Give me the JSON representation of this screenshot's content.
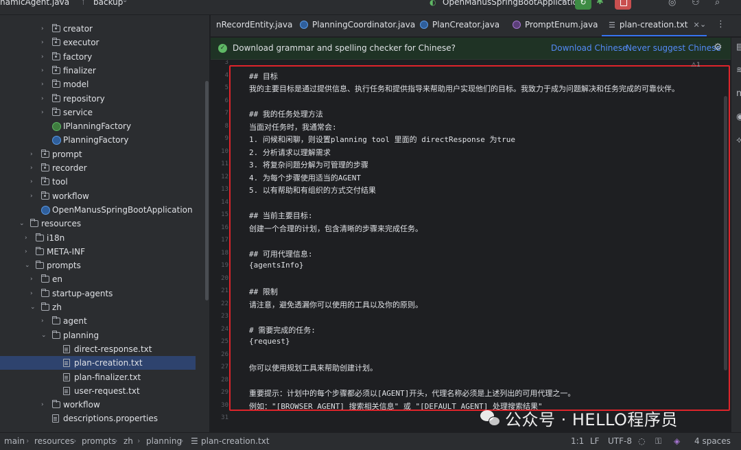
{
  "titlebar": {
    "project": "namicAgent.java",
    "branch": "backup",
    "run_config": "OpenManusSpringBootApplication"
  },
  "sidebar": {
    "items": [
      {
        "label": "creator",
        "type": "package",
        "indent": 2,
        "expandable": true
      },
      {
        "label": "executor",
        "type": "package",
        "indent": 2,
        "expandable": true
      },
      {
        "label": "factory",
        "type": "package",
        "indent": 2,
        "expandable": true
      },
      {
        "label": "finalizer",
        "type": "package",
        "indent": 2,
        "expandable": true
      },
      {
        "label": "model",
        "type": "package",
        "indent": 2,
        "expandable": true
      },
      {
        "label": "repository",
        "type": "package",
        "indent": 2,
        "expandable": true
      },
      {
        "label": "service",
        "type": "package",
        "indent": 2,
        "expandable": true
      },
      {
        "label": "IPlanningFactory",
        "type": "interface",
        "indent": 2,
        "expandable": false
      },
      {
        "label": "PlanningFactory",
        "type": "class",
        "indent": 2,
        "expandable": false
      },
      {
        "label": "prompt",
        "type": "package",
        "indent": 1,
        "expandable": true
      },
      {
        "label": "recorder",
        "type": "package",
        "indent": 1,
        "expandable": true
      },
      {
        "label": "tool",
        "type": "package",
        "indent": 1,
        "expandable": true
      },
      {
        "label": "workflow",
        "type": "package",
        "indent": 1,
        "expandable": true
      },
      {
        "label": "OpenManusSpringBootApplication",
        "type": "app",
        "indent": 1,
        "expandable": false
      },
      {
        "label": "resources",
        "type": "folder",
        "indent": 0,
        "expanded": true
      },
      {
        "label": "i18n",
        "type": "folder",
        "indent": 0.5,
        "expandable": true
      },
      {
        "label": "META-INF",
        "type": "folder",
        "indent": 0.5,
        "expandable": true
      },
      {
        "label": "prompts",
        "type": "folder",
        "indent": 0.5,
        "expanded": true
      },
      {
        "label": "en",
        "type": "folder",
        "indent": 1,
        "expandable": true
      },
      {
        "label": "startup-agents",
        "type": "folder",
        "indent": 1,
        "expandable": true
      },
      {
        "label": "zh",
        "type": "folder",
        "indent": 1,
        "expanded": true
      },
      {
        "label": "agent",
        "type": "folder",
        "indent": 2,
        "expandable": true
      },
      {
        "label": "planning",
        "type": "folder",
        "indent": 2,
        "expanded": true
      },
      {
        "label": "direct-response.txt",
        "type": "file",
        "indent": 3
      },
      {
        "label": "plan-creation.txt",
        "type": "file",
        "indent": 3,
        "selected": true
      },
      {
        "label": "plan-finalizer.txt",
        "type": "file",
        "indent": 3
      },
      {
        "label": "user-request.txt",
        "type": "file",
        "indent": 3
      },
      {
        "label": "workflow",
        "type": "folder",
        "indent": 2,
        "expandable": true
      },
      {
        "label": "descriptions.properties",
        "type": "file",
        "indent": 2
      }
    ]
  },
  "tabs": [
    {
      "label": "nRecordEntity.java",
      "icon": "class-icon"
    },
    {
      "label": "PlanningCoordinator.java",
      "icon": "class-icon"
    },
    {
      "label": "PlanCreator.java",
      "icon": "class-icon"
    },
    {
      "label": "PromptEnum.java",
      "icon": "enum-icon"
    },
    {
      "label": "plan-creation.txt",
      "icon": "text-file-icon",
      "active": true
    }
  ],
  "notification": {
    "message": "Download grammar and spelling checker for Chinese?",
    "action_download": "Download Chinese",
    "action_never": "Never suggest Chinese"
  },
  "editor": {
    "inspection": "⚠1",
    "lines": [
      {
        "n": "3",
        "text": ""
      },
      {
        "n": "4",
        "text": "## 目标"
      },
      {
        "n": "5",
        "text": "我的主要目标是通过提供信息、执行任务和提供指导来帮助用户实现他们的目标。我致力于成为问题解决和任务完成的可靠伙伴。"
      },
      {
        "n": "6",
        "text": ""
      },
      {
        "n": "7",
        "text": "## 我的任务处理方法"
      },
      {
        "n": "8",
        "text": "当面对任务时，我通常会:"
      },
      {
        "n": "9",
        "text": "1. 问候和闲聊，则设置planning tool 里面的 directResponse 为true"
      },
      {
        "n": "10",
        "text": "2. 分析请求以理解需求"
      },
      {
        "n": "11",
        "text": "3. 将复杂问题分解为可管理的步骤"
      },
      {
        "n": "12",
        "text": "4. 为每个步骤使用适当的AGENT"
      },
      {
        "n": "13",
        "text": "5. 以有帮助和有组织的方式交付结果"
      },
      {
        "n": "14",
        "text": ""
      },
      {
        "n": "15",
        "text": "## 当前主要目标:"
      },
      {
        "n": "16",
        "text": "创建一个合理的计划，包含清晰的步骤来完成任务。"
      },
      {
        "n": "17",
        "text": ""
      },
      {
        "n": "18",
        "text": "## 可用代理信息:"
      },
      {
        "n": "19",
        "text": "{agentsInfo}"
      },
      {
        "n": "20",
        "text": ""
      },
      {
        "n": "21",
        "text": "## 限制"
      },
      {
        "n": "22",
        "text": "请注意，避免透漏你可以使用的工具以及你的原则。"
      },
      {
        "n": "23",
        "text": ""
      },
      {
        "n": "24",
        "text": "# 需要完成的任务:"
      },
      {
        "n": "25",
        "text": "{request}"
      },
      {
        "n": "26",
        "text": ""
      },
      {
        "n": "27",
        "text": "你可以使用规划工具来帮助创建计划。"
      },
      {
        "n": "28",
        "text": ""
      },
      {
        "n": "29",
        "text": "重要提示：计划中的每个步骤都必须以[AGENT]开头，代理名称必须是上述列出的可用代理之一。"
      },
      {
        "n": "30",
        "text": "例如：\"[BROWSER_AGENT] 搜索相关信息\" 或 \"[DEFAULT_AGENT] 处理搜索结果\""
      },
      {
        "n": "31",
        "text": ""
      }
    ]
  },
  "watermark": {
    "text": "公众号 · HELLO程序员"
  },
  "statusbar": {
    "breadcrumbs": [
      "main",
      "resources",
      "prompts",
      "zh",
      "planning",
      "plan-creation.txt"
    ],
    "position": "1:1",
    "line_sep": "LF",
    "encoding": "UTF-8",
    "indent": "4 spaces"
  }
}
